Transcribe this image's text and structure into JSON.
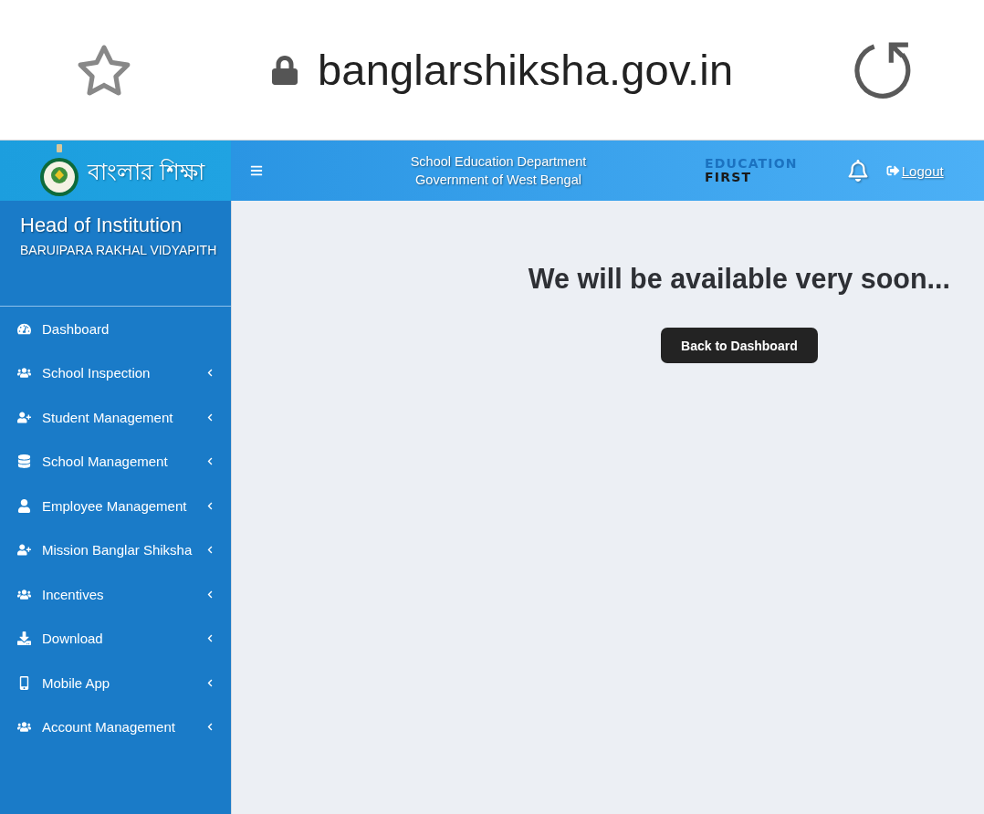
{
  "browser": {
    "url": "banglarshiksha.gov.in"
  },
  "header": {
    "logo_text": "বাংলার শিক্ষা",
    "department": "School Education Department",
    "government": "Government of West Bengal",
    "brand_lines": [
      "EDUCATION",
      "FIRST"
    ],
    "logout": "Logout"
  },
  "sidebar": {
    "role": "Head of Institution",
    "school": "BARUIPARA RAKHAL VIDYAPITH",
    "items": [
      {
        "label": "Dashboard",
        "kind": "link"
      },
      {
        "label": "School Inspection",
        "kind": "group"
      },
      {
        "label": "Student Management",
        "kind": "group"
      },
      {
        "label": "School Management",
        "kind": "group"
      },
      {
        "label": "Employee Management",
        "kind": "group"
      },
      {
        "label": "Mission Banglar Shiksha",
        "kind": "group"
      },
      {
        "label": "Incentives",
        "kind": "group"
      },
      {
        "label": "Download",
        "kind": "group"
      },
      {
        "label": "Mobile App",
        "kind": "group"
      },
      {
        "label": "Account Management",
        "kind": "group"
      }
    ]
  },
  "main": {
    "message": "We will be available very soon...",
    "button": "Back to Dashboard"
  }
}
